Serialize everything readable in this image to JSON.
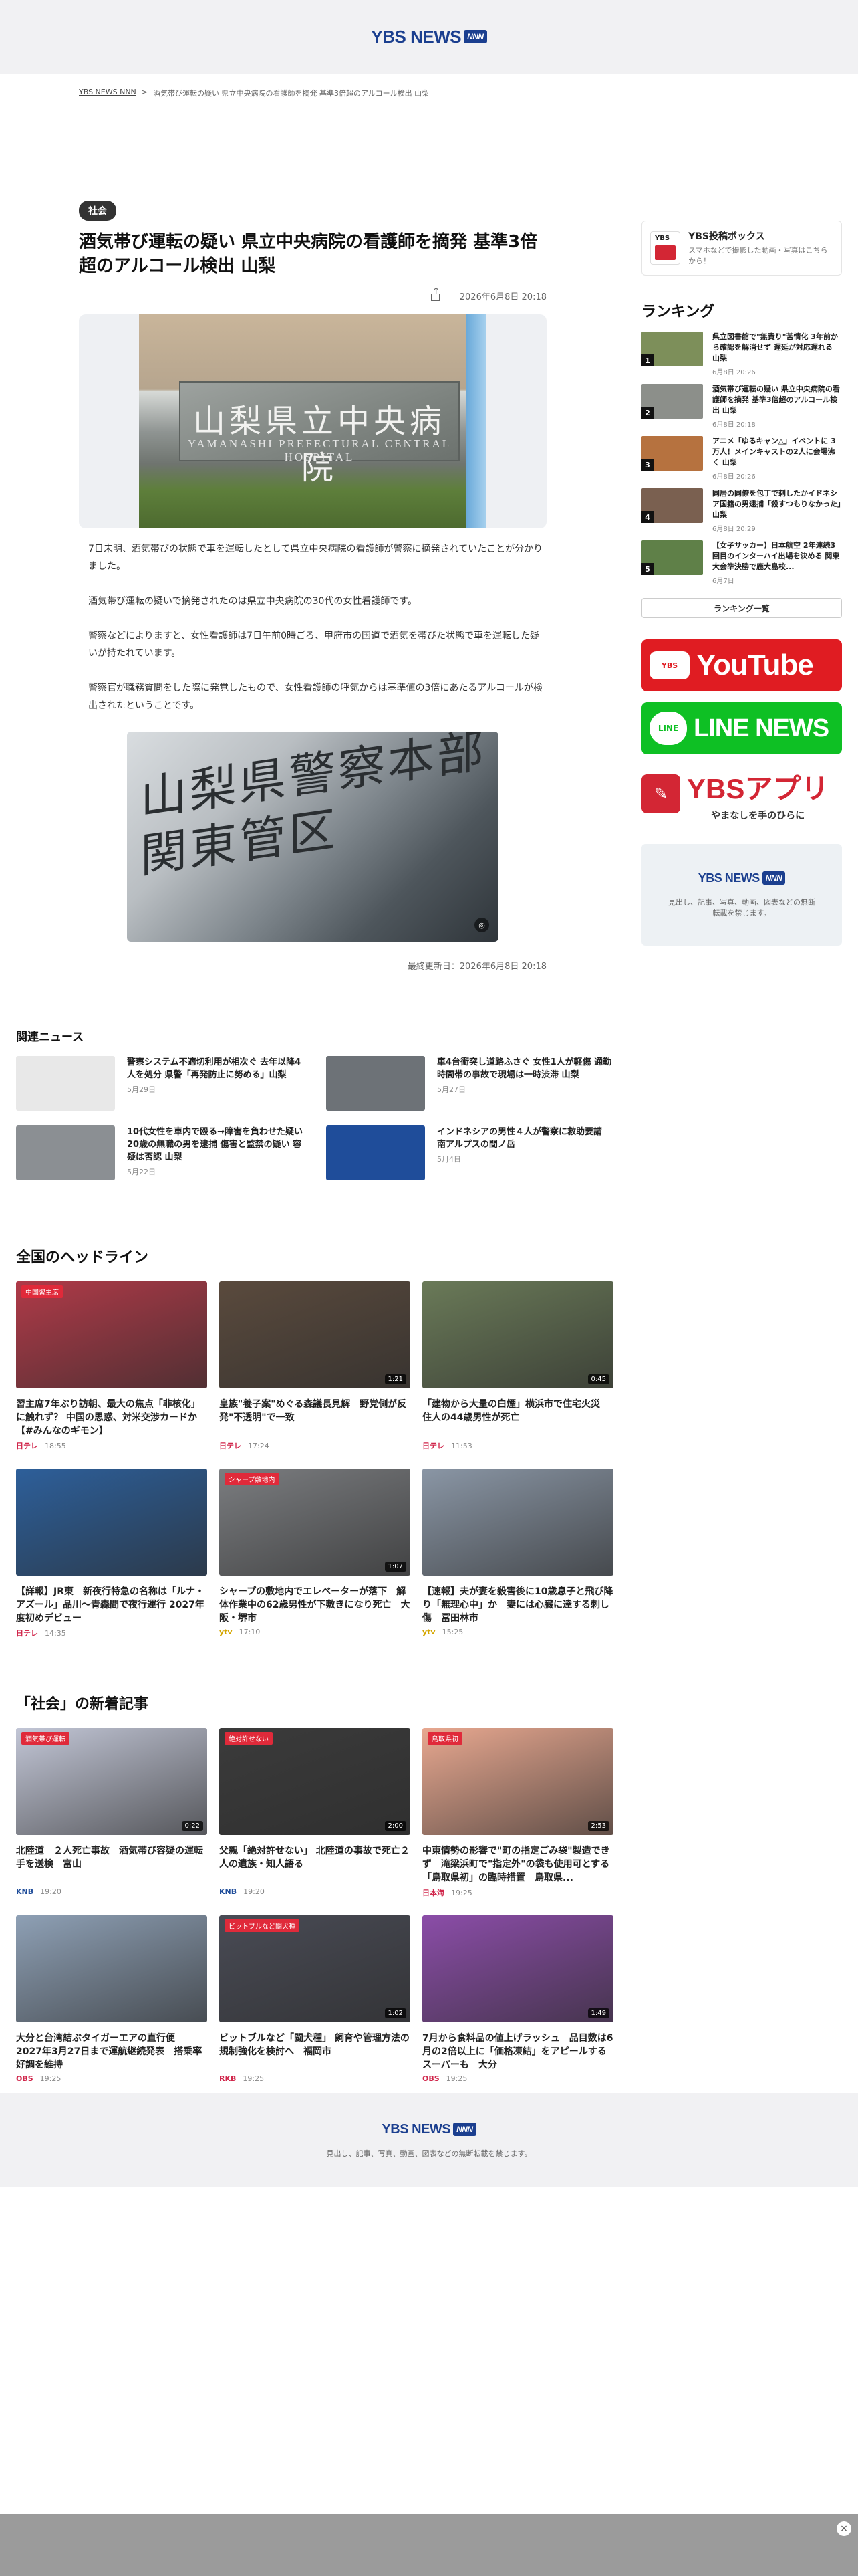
{
  "header": {
    "logo_text": "YBS NEWS",
    "logo_badge": "NNN"
  },
  "breadcrumb": {
    "home": "YBS NEWS NNN",
    "separator": ">",
    "current": "酒気帯び運転の疑い 県立中央病院の看護師を摘発 基準3倍超のアルコール検出 山梨"
  },
  "article": {
    "category": "社会",
    "title": "酒気帯び運転の疑い 県立中央病院の看護師を摘発 基準3倍超のアルコール検出 山梨",
    "published": "2026年6月8日 20:18",
    "hero_sign": "山梨県立中央病院",
    "hero_sign_en": "YAMANASHI PREFECTURAL CENTRAL HOSPITAL",
    "photo2_text": "山梨県警察本部 関東管区",
    "paragraphs": [
      "7日未明、酒気帯びの状態で車を運転したとして県立中央病院の看護師が警察に摘発されていたことが分かりました。",
      "酒気帯び運転の疑いで摘発されたのは県立中央病院の30代の女性看護師です。",
      "警察などによりますと、女性看護師は7日午前0時ごろ、甲府市の国道で酒気を帯びた状態で車を運転した疑いが持たれています。",
      "警察官が職務質問をした際に発覚したもので、女性看護師の呼気からは基準値の3倍にあたるアルコールが検出されたということです。"
    ],
    "updated": "最終更新日：2026年6月8日 20:18"
  },
  "related": {
    "heading": "関連ニュース",
    "items": [
      {
        "title": "警察システム不適切利用が相次ぐ 去年以降4人を処分 県警「再発防止に努める」山梨",
        "date": "5月29日",
        "color": "#e8e8e8"
      },
      {
        "title": "車4台衝突し道路ふさぐ 女性1人が軽傷 通勤時間帯の事故で現場は一時渋滞 山梨",
        "date": "5月27日",
        "color": "#6d7277"
      },
      {
        "title": "10代女性を車内で殴る→障害を負わせた疑い 20歳の無職の男を逮捕 傷害と監禁の疑い 容疑は否認 山梨",
        "date": "5月22日",
        "color": "#8b8f93"
      },
      {
        "title": "インドネシアの男性４人が警察に救助要請　南アルプスの間ノ岳",
        "date": "5月4日",
        "color": "#1f4d9a"
      }
    ]
  },
  "national": {
    "heading": "全国のヘッドライン",
    "items": [
      {
        "title": "習主席7年ぶり訪朝、最大の焦点「非核化」に触れず？ 中国の思惑、対米交渉カードか【#みんなのギモン】",
        "source": "日テレ",
        "time": "18:55",
        "duration": "",
        "caption": "中国習主席",
        "color": "#b03a48"
      },
      {
        "title": "皇族\"養子案\"めぐる森議長見解　野党側が反発\"不透明\"で一致",
        "source": "日テレ",
        "time": "17:24",
        "duration": "1:21",
        "caption": "",
        "color": "#5a4a3d"
      },
      {
        "title": "「建物から大量の白煙」横浜市で住宅火災　住人の44歳男性が死亡",
        "source": "日テレ",
        "time": "11:53",
        "duration": "0:45",
        "caption": "",
        "color": "#6a7a58"
      },
      {
        "title": "【詳報】JR東　新夜行特急の名称は「ルナ・アズール」品川〜青森間で夜行運行 2027年度初めデビュー",
        "source": "日テレ",
        "time": "14:35",
        "duration": "",
        "caption": "",
        "color": "#2d5f9a"
      },
      {
        "title": "シャープの敷地内でエレベーターが落下　解体作業中の62歳男性が下敷きになり死亡　大阪・堺市",
        "source": "ytv",
        "time": "17:10",
        "duration": "1:07",
        "caption": "シャープ敷地内",
        "color": "#7b7d80"
      },
      {
        "title": "【速報】夫が妻を殺害後に10歳息子と飛び降り「無理心中」か　妻には心臓に達する刺し傷　冨田林市",
        "source": "ytv",
        "time": "15:25",
        "duration": "",
        "caption": "",
        "color": "#8a96a5"
      }
    ]
  },
  "society": {
    "heading": "「社会」の新着記事",
    "items": [
      {
        "title": "北陸道　２人死亡事故　酒気帯び容疑の運転手を送検　富山",
        "source": "KNB",
        "time": "19:20",
        "duration": "0:22",
        "caption": "酒気帯び運転",
        "color": "#c2c6d6"
      },
      {
        "title": "父親「絶対許せない」 北陸道の事故で死亡２人の遺族・知人語る",
        "source": "KNB",
        "time": "19:20",
        "duration": "2:00",
        "caption": "絶対許せない",
        "color": "#3b3b3b"
      },
      {
        "title": "中東情勢の影響で\"町の指定ごみ袋\"製造できず　滝梁浜町で\"指定外\"の袋も使用可とする「鳥取県初」の臨時措置　鳥取県...",
        "source": "日本海",
        "time": "19:25",
        "duration": "2:53",
        "caption": "鳥取県初",
        "color": "#e8a890"
      },
      {
        "title": "大分と台湾結ぶタイガーエアの直行便　2027年3月27日まで運航継続発表　搭乗率好調を維持",
        "source": "OBS",
        "time": "19:25",
        "duration": "",
        "caption": "",
        "color": "#8ea0b5"
      },
      {
        "title": "ビットブルなど「闘犬種」 飼育や管理方法の規制強化を検討へ　福岡市",
        "source": "RKB",
        "time": "19:25",
        "duration": "1:02",
        "caption": "ビットブルなど闘犬種",
        "color": "#494b55"
      },
      {
        "title": "7月から食料品の値上げラッシュ　品目数は6月の2倍以上に「価格凍結」をアピールするスーパーも　大分",
        "source": "OBS",
        "time": "19:25",
        "duration": "1:49",
        "caption": "",
        "color": "#8b4da8"
      }
    ]
  },
  "sidebar": {
    "post_title": "YBS投稿ボックス",
    "post_desc": "スマホなどで撮影した動画・写真はこちらから！",
    "ranking_heading": "ランキング",
    "ranking": [
      {
        "num": "1",
        "title": "県立図書館で\"無責り\"苦情化 3年前から確認を解消せず 遅延が対応遅れる 山梨",
        "date": "6月8日 20:26",
        "color": "#7d8f5a"
      },
      {
        "num": "2",
        "title": "酒気帯び運転の疑い 県立中央病院の看護師を摘発 基準3倍超のアルコール検出 山梨",
        "date": "6月8日 20:18",
        "color": "#8c8f8a"
      },
      {
        "num": "3",
        "title": "アニメ「ゆるキャン△」イベントに 3万人！メインキャストの2人に会場沸く 山梨",
        "date": "6月8日 20:26",
        "color": "#b6723f"
      },
      {
        "num": "4",
        "title": "同居の同僚を包丁で刺したかイドネシア国籍の男逮捕「殺すつもりなかった」山梨",
        "date": "6月8日 20:29",
        "color": "#7a6050"
      },
      {
        "num": "5",
        "title": "【女子サッカー】日本航空 2年連続3回目のインターハイ出場を決める 関東大会準決勝で鹿大島校...",
        "date": "6月7日",
        "color": "#5f8048"
      }
    ],
    "ranking_more": "ランキング一覧",
    "youtube_badge": "YBS",
    "youtube_text": "YouTube",
    "line_badge": "LINE",
    "line_text": "LINE NEWS",
    "app_main": "YBSアプリ",
    "app_sub": "やまなしを手のひらに",
    "promo_logo": "YBS NEWS",
    "promo_badge": "NNN",
    "promo_text": "見出し、記事、写真、動画、図表などの無断転載を禁じます。"
  },
  "footer": {
    "logo": "YBS NEWS",
    "badge": "NNN",
    "text": "見出し、記事、写真、動画、図表などの無断転載を禁じます。"
  },
  "ad": {
    "close_label": "×"
  }
}
